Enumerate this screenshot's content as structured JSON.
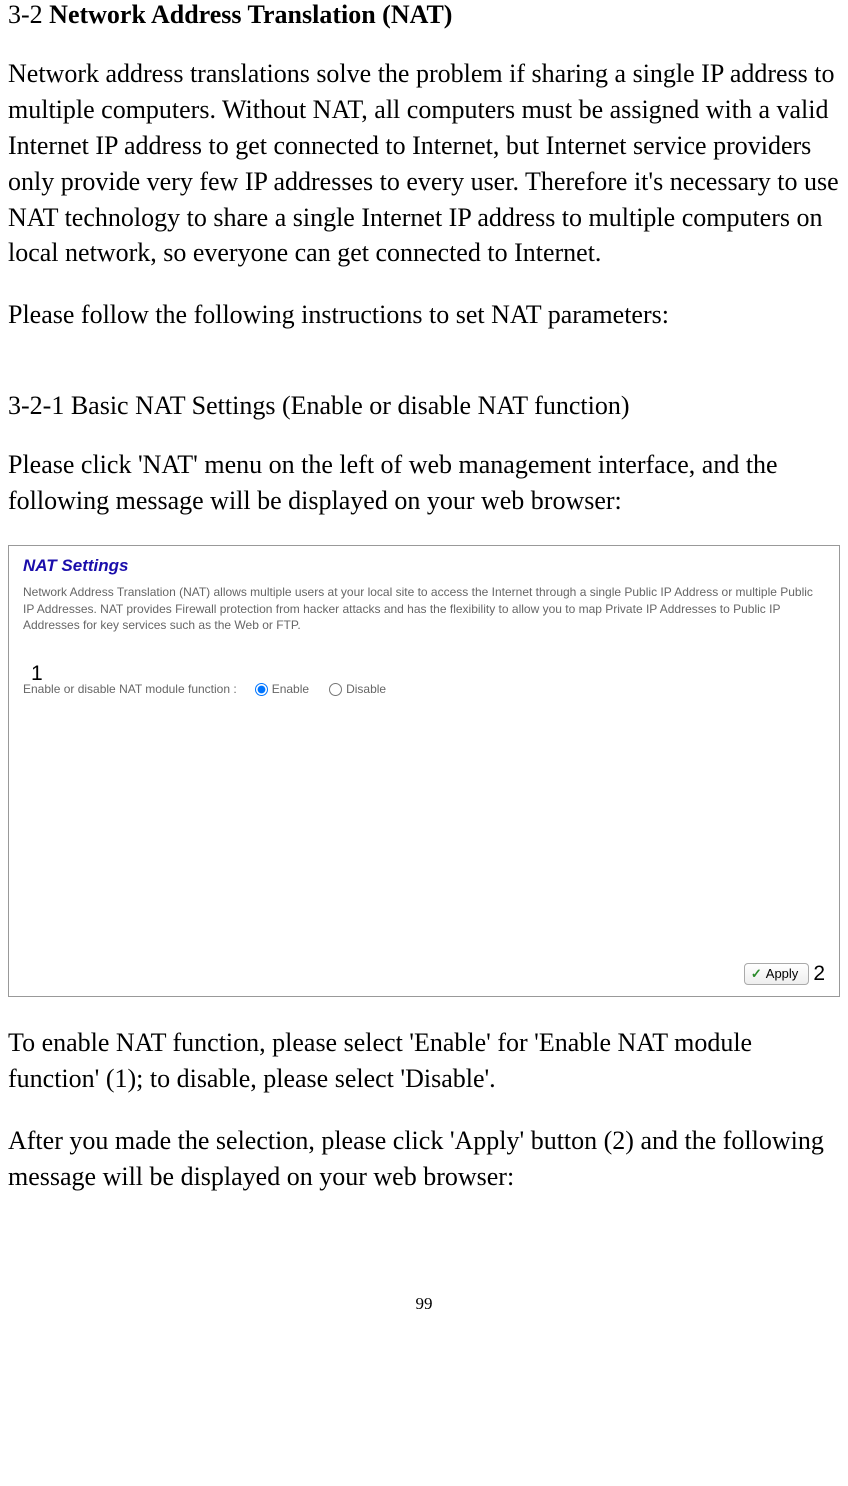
{
  "section": {
    "number": "3-2 ",
    "title": "Network Address Translation (NAT)"
  },
  "paragraphs": {
    "intro": "Network address translations solve the problem if sharing a single IP address to multiple computers. Without NAT, all computers must be assigned with a valid Internet IP address to get connected to Internet, but Internet service providers only provide very few IP addresses to every user. Therefore it's necessary to use NAT technology to share a single Internet IP address to multiple computers on local network, so everyone can get connected to Internet.",
    "instructions": "Please follow the following instructions to set NAT parameters:",
    "subsection_title": "3-2-1 Basic NAT Settings (Enable or disable NAT function)",
    "click_nat": "Please click 'NAT' menu on the left of web management interface, and the following message will be displayed on your web browser:",
    "enable_instructions": "To enable NAT function, please select 'Enable' for 'Enable NAT module function' (1); to disable, please select 'Disable'.",
    "apply_instructions": "After you made the selection, please click 'Apply' button (2) and the following message will be displayed on your web browser:"
  },
  "screenshot": {
    "title": "NAT Settings",
    "description": "Network Address Translation (NAT) allows multiple users at your local site to access the Internet through a single Public IP Address or multiple Public IP Addresses. NAT provides Firewall protection from hacker attacks and has the flexibility to allow you to map Private IP Addresses to Public IP Addresses for key services such as the Web or FTP.",
    "callout1": "1",
    "toggle_label": "Enable or disable NAT module function :",
    "enable_label": "Enable",
    "disable_label": "Disable",
    "apply_label": "Apply",
    "callout2": "2"
  },
  "page_number": "99"
}
